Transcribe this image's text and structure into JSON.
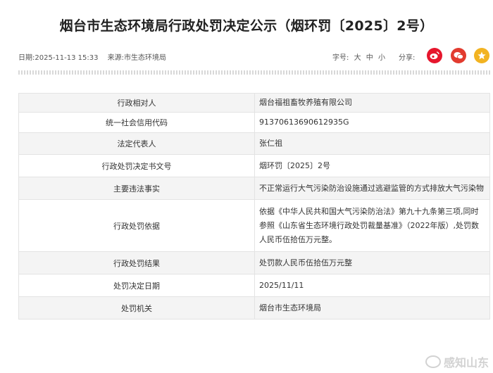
{
  "title": "烟台市生态环境局行政处罚决定公示（烟环罚〔2025〕2号）",
  "meta": {
    "date": "日期:2025-11-13 15:33",
    "source": "来源:市生态环境局"
  },
  "font_size": {
    "label": "字号:",
    "options": [
      "大",
      "中",
      "小"
    ]
  },
  "share": {
    "label": "分享:",
    "icons": [
      "weibo-icon",
      "wechat-icon",
      "favorite-star-icon"
    ]
  },
  "rows": [
    {
      "k": "行政相对人",
      "v": "烟台福祖畜牧养殖有限公司"
    },
    {
      "k": "统一社会信用代码",
      "v": "91370613690612935G"
    },
    {
      "k": "法定代表人",
      "v": "张仁祖"
    },
    {
      "k": "行政处罚决定书文号",
      "v": "烟环罚〔2025〕2号"
    },
    {
      "k": "主要违法事实",
      "v": "不正常运行大气污染防治设施通过逃避监管的方式排放大气污染物"
    },
    {
      "k": "行政处罚依据",
      "v": "依据《中华人民共和国大气污染防治法》第九十九条第三项,同时参照《山东省生态环境行政处罚裁量基准》（2022年版）,处罚数人民币伍拾伍万元整。"
    },
    {
      "k": "行政处罚结果",
      "v": "处罚款人民币伍拾伍万元整"
    },
    {
      "k": "处罚决定日期",
      "v": "2025/11/11"
    },
    {
      "k": "处罚机关",
      "v": "烟台市生态环境局"
    }
  ],
  "watermark": "感知山东"
}
